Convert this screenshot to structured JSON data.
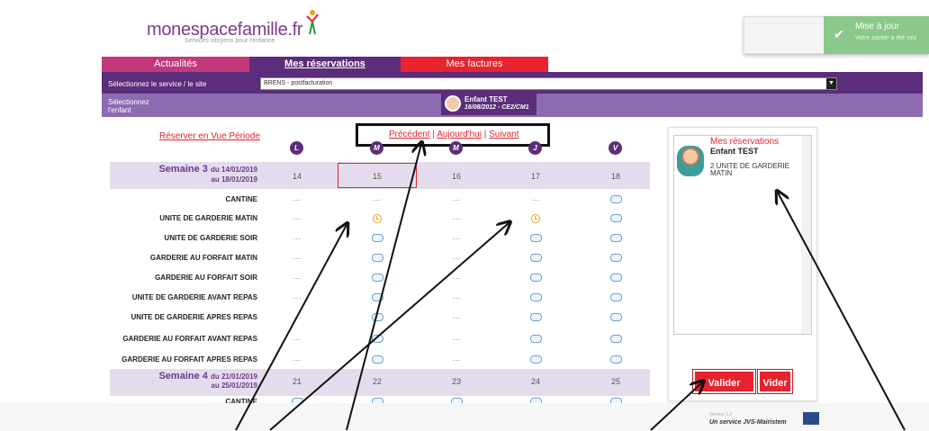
{
  "header": {
    "logo_main": "monespacefamille",
    "logo_tld": ".fr",
    "logo_tagline": "Services citoyens pour l'enfance",
    "toast_title": "Mise à jour",
    "toast_text": "Votre panier a été mis"
  },
  "tabs": [
    {
      "label": "Actualités"
    },
    {
      "label": "Mes réservations"
    },
    {
      "label": "Mes factures"
    }
  ],
  "service_bar": {
    "label": "Sélectionnez le service / le site",
    "selected": "BRENS - postfacturation"
  },
  "child_bar": {
    "label_line1": "Sélectionnez",
    "label_line2": "l'enfant",
    "child_name": "Enfant TEST",
    "child_info": "16/08/2012 - CE2/CM1"
  },
  "grid": {
    "reserve_link": "Réserver en Vue Période",
    "nav_prev": "Précédent",
    "nav_today": "Aujourd'hui",
    "nav_next": "Suivant",
    "nav_sep": "|",
    "day_letters": [
      "L",
      "M",
      "M",
      "J",
      "V"
    ],
    "week3": {
      "title": "Semaine 3",
      "from": "du 14/01/2019",
      "to": "au 18/01/2019",
      "days": [
        "14",
        "15",
        "16",
        "17",
        "18"
      ]
    },
    "week4": {
      "title": "Semaine 4",
      "from": "du 21/01/2019",
      "to": "au 25/01/2019",
      "days": [
        "21",
        "22",
        "23",
        "24",
        "25"
      ]
    },
    "activities": [
      "CANTINE",
      "UNITE DE GARDERIE MATIN",
      "UNITE DE GARDERIE SOIR",
      "GARDERIE AU FORFAIT MATIN",
      "GARDERIE AU FORFAIT SOIR",
      "UNITE DE GARDERIE AVANT REPAS",
      "UNITE DE GARDERIE APRES REPAS",
      "GARDERIE AU FORFAIT AVANT REPAS",
      "GARDERIE AU FORFAIT APRES REPAS"
    ],
    "week4_first_activity": "CANTINE",
    "dots": "···"
  },
  "panel": {
    "title": "Mes réservations",
    "child_name": "Enfant TEST",
    "item": "2 UNITE DE GARDERIE MATIN",
    "validate": "Valider",
    "clear": "Vider"
  },
  "footer": {
    "version": "Version 1.2",
    "text": "Un service JVS-Mairistem"
  },
  "colors": {
    "purple": "#5c2d7a",
    "light_purple": "#8c6bb0",
    "red": "#e8222e",
    "pink": "#c2387a"
  }
}
